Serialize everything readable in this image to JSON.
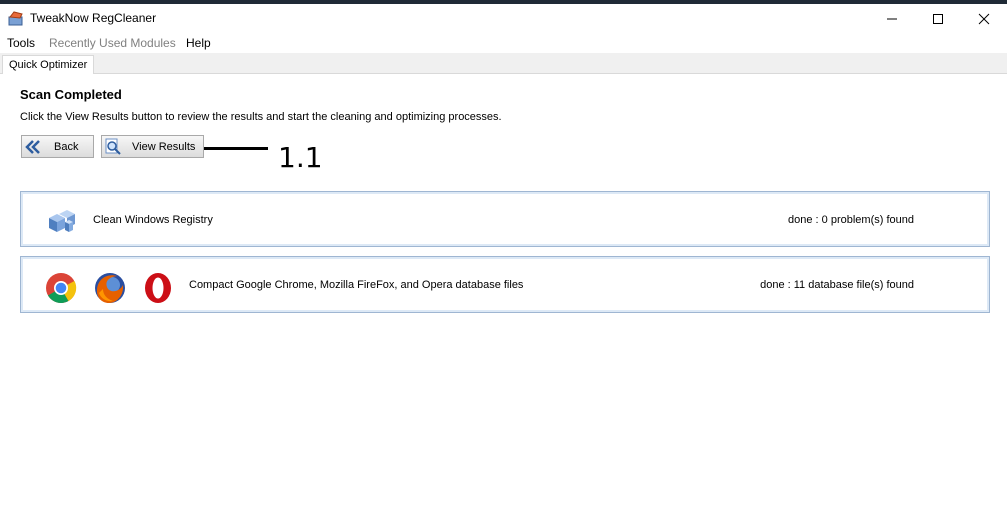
{
  "window": {
    "title": "TweakNow RegCleaner"
  },
  "menu": {
    "items": [
      {
        "label": "Tools",
        "enabled": true
      },
      {
        "label": "Recently Used Modules",
        "enabled": false
      },
      {
        "label": "Help",
        "enabled": true
      }
    ]
  },
  "tabs": [
    {
      "label": "Quick Optimizer",
      "selected": true
    }
  ],
  "main": {
    "heading": "Scan Completed",
    "description": "Click the View Results button to review the results and start the cleaning and optimizing processes.",
    "buttons": {
      "back": "Back",
      "view_results": "View Results"
    },
    "annotation": "1.1"
  },
  "panels": [
    {
      "label": "Clean Windows Registry",
      "status": "done : 0 problem(s) found",
      "icons": [
        "registry-cubes-icon"
      ]
    },
    {
      "label": "Compact Google Chrome, Mozilla FireFox, and Opera database files",
      "status": "done : 11 database file(s) found",
      "icons": [
        "chrome-icon",
        "firefox-icon",
        "opera-icon"
      ]
    }
  ],
  "colors": {
    "panel_border": "#9fb6d2",
    "tab_strip": "#f0f0f0",
    "disabled_text": "#808080"
  }
}
